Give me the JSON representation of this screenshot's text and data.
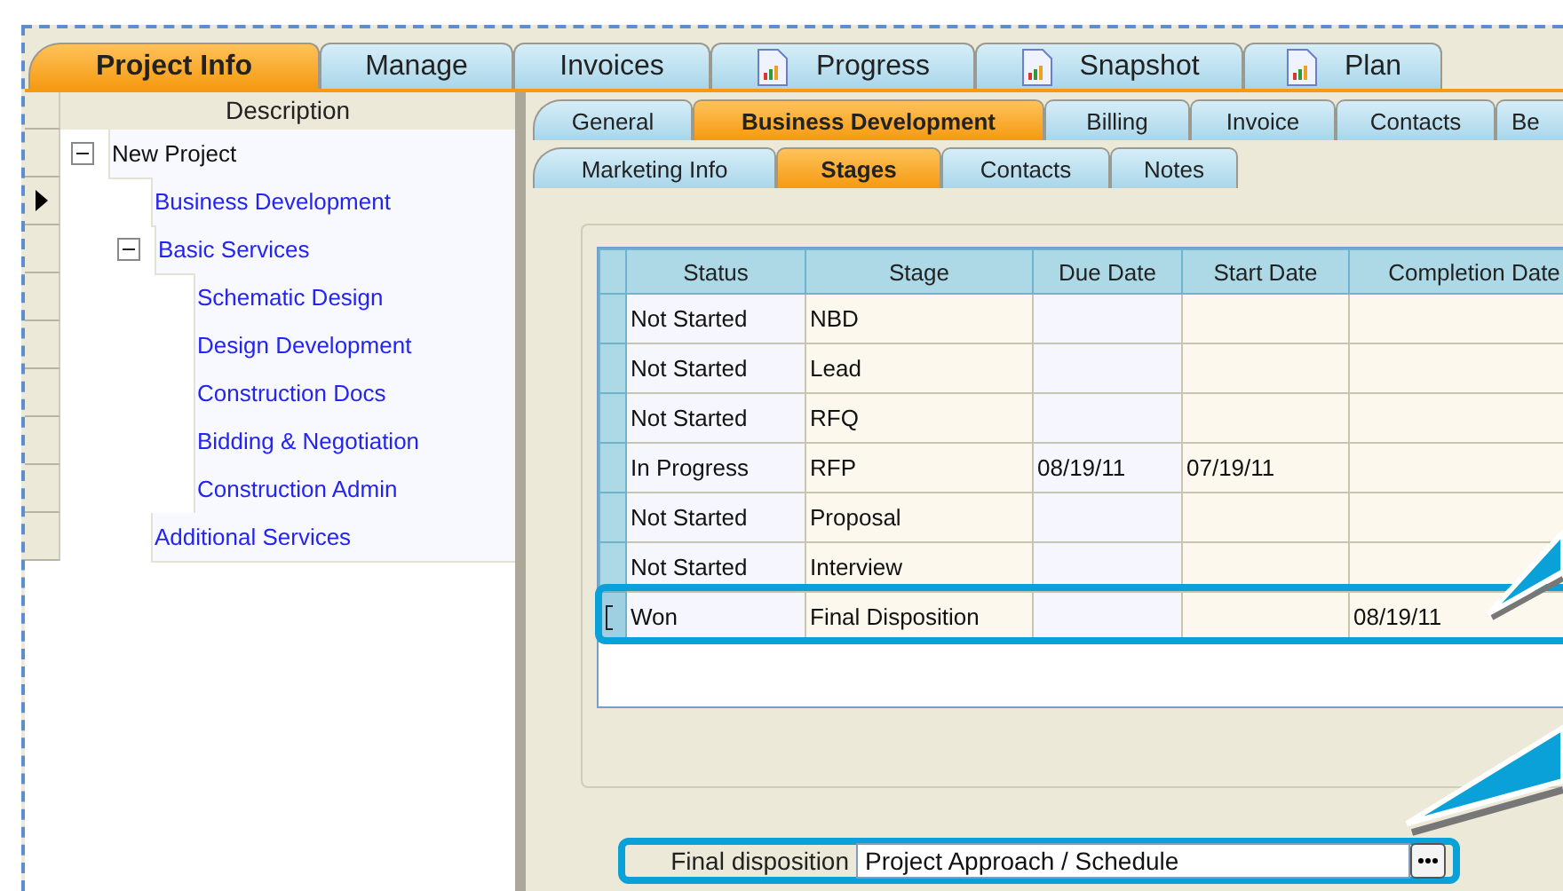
{
  "main_tabs": [
    {
      "label": "Project Info",
      "selected": true,
      "kind": "plain"
    },
    {
      "label": "Manage",
      "selected": false,
      "kind": "plain"
    },
    {
      "label": "Invoices",
      "selected": false,
      "kind": "plain"
    },
    {
      "label": "Progress",
      "selected": false,
      "kind": "report"
    },
    {
      "label": "Snapshot",
      "selected": false,
      "kind": "report"
    },
    {
      "label": "Plan",
      "selected": false,
      "kind": "report"
    }
  ],
  "tree": {
    "header": "Description",
    "items": [
      {
        "label": "New Project",
        "expanded": true,
        "current": false,
        "children": [
          {
            "label": "Business Development",
            "current": true
          },
          {
            "label": "Basic Services",
            "expanded": true,
            "current": false,
            "children": [
              {
                "label": "Schematic Design",
                "current": false
              },
              {
                "label": "Design Development",
                "current": false
              },
              {
                "label": "Construction Docs",
                "current": false
              },
              {
                "label": "Bidding & Negotiation",
                "current": false
              },
              {
                "label": "Construction Admin",
                "current": false
              }
            ]
          },
          {
            "label": "Additional Services",
            "current": false
          }
        ]
      }
    ]
  },
  "detail_tabs": [
    {
      "label": "General",
      "selected": false
    },
    {
      "label": "Business Development",
      "selected": true
    },
    {
      "label": "Billing",
      "selected": false
    },
    {
      "label": "Invoice",
      "selected": false
    },
    {
      "label": "Contacts",
      "selected": false
    },
    {
      "label": "Be",
      "selected": false
    }
  ],
  "sub_tabs": [
    {
      "label": "Marketing Info",
      "selected": false
    },
    {
      "label": "Stages",
      "selected": true
    },
    {
      "label": "Contacts",
      "selected": false
    },
    {
      "label": "Notes",
      "selected": false
    }
  ],
  "table": {
    "columns": [
      "Status",
      "Stage",
      "Due Date",
      "Start Date",
      "Completion Date"
    ],
    "rows": [
      {
        "cells": [
          "Not Started",
          "NBD",
          "",
          "",
          ""
        ],
        "highlighted": false,
        "editing": false
      },
      {
        "cells": [
          "Not Started",
          "Lead",
          "",
          "",
          ""
        ],
        "highlighted": false,
        "editing": false
      },
      {
        "cells": [
          "Not Started",
          "RFQ",
          "",
          "",
          ""
        ],
        "highlighted": false,
        "editing": false
      },
      {
        "cells": [
          "In Progress",
          "RFP",
          "08/19/11",
          "07/19/11",
          ""
        ],
        "highlighted": false,
        "editing": false
      },
      {
        "cells": [
          "Not Started",
          "Proposal",
          "",
          "",
          ""
        ],
        "highlighted": false,
        "editing": false
      },
      {
        "cells": [
          "Not Started",
          "Interview",
          "",
          "",
          ""
        ],
        "highlighted": false,
        "editing": false
      },
      {
        "cells": [
          "Won",
          "Final Disposition",
          "",
          "",
          "08/19/11"
        ],
        "highlighted": true,
        "editing": true
      }
    ]
  },
  "final_disposition": {
    "label": "Final disposition",
    "value": "Project Approach / Schedule",
    "highlighted": true
  }
}
